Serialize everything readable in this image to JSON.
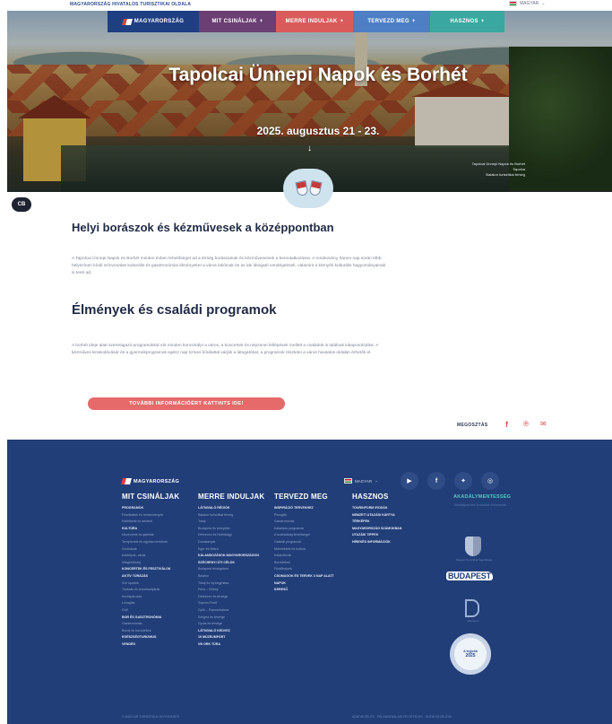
{
  "topbar": {
    "site": "MAGYARORSZÁG HIVATALOS TURISZTIKAI OLDALA",
    "language": "MAGYAR"
  },
  "nav": {
    "brand": "MAGYARORSZÁG",
    "items": [
      {
        "label": "MIT CSINÁLJAK"
      },
      {
        "label": "MERRE INDULJAK"
      },
      {
        "label": "TERVEZD MEG"
      },
      {
        "label": "HASZNOS"
      }
    ],
    "plus": "+"
  },
  "hero": {
    "title": "Tapolcai Ünnepi Napok és Borhét",
    "date": "2025. augusztus 21 - 23.",
    "arrow": "↓",
    "caption": "Tapolcai Ünnepi Napok és Borhét\nTapolca\nBalaton turisztikai térség"
  },
  "cookie_badge": "CB",
  "content": {
    "heading1": "Helyi borászok és kézművesek a középpontban",
    "para1": "A Tapolcai Ünnepi Napok és Borhét minden évben lehetőséget ad a térség borászainak és kézműveseinek a bemutatkozásra. A rendezvény három nap során több helyszínen kínál színvonalas kulturális és gasztronómiai élményeket a város lakóinak és az ide látogató vendégeknek, valamint a környék kulturális hagyományainak is teret ad.",
    "heading2": "Élmények és családi programok",
    "para2": "A borhét ideje alatt szerteágazó programokkal vár minden korosztályt a város, a koncertek és népzenei fellépések mellett a családok is találnak kikapcsolódást. A kézműves kirakodóvásár és a gyermekprogramok egész nap színes kínálattal várják a látogatókat, a programok részletei a város hivatalos oldalán érhetők el.",
    "cta": "TOVÁBBI INFORMÁCIÓÉRT KATTINTS IDE!",
    "share": "MEGOSZTÁS"
  },
  "footer": {
    "brand": "MAGYARORSZÁG",
    "language": "MAGYAR",
    "columns": [
      {
        "title": "MIT CSINÁLJAK",
        "items": [
          {
            "t": "PROGRAMOK",
            "b": true
          },
          {
            "t": "Fesztiválok és rendezvények",
            "b": false
          },
          {
            "t": "Kiállítások és tárlatok",
            "b": false
          },
          {
            "t": "KULTÚRA",
            "b": true
          },
          {
            "t": "Múzeumok és galériák",
            "b": false
          },
          {
            "t": "Templomok és egyházi emlékek",
            "b": false
          },
          {
            "t": "Színházak",
            "b": false
          },
          {
            "t": "Kastélyok, várak",
            "b": false
          },
          {
            "t": "Világörökség",
            "b": false
          },
          {
            "t": "KONCERTEK ÉS FESZTIVÁLOK",
            "b": true
          },
          {
            "t": "AKTÍV TÚRÁZÁS",
            "b": true
          },
          {
            "t": "Vízi sportok",
            "b": false
          },
          {
            "t": "Túrázás és természetjárás",
            "b": false
          },
          {
            "t": "Kerékpározás",
            "b": false
          },
          {
            "t": "Lovaglás",
            "b": false
          },
          {
            "t": "Golf",
            "b": false
          },
          {
            "t": "BOR ÉS GASZTRONÓMIA",
            "b": true
          },
          {
            "t": "Gasztronómia",
            "b": false
          },
          {
            "t": "Borok és borvidékek",
            "b": false
          },
          {
            "t": "EGÉSZSÉGTURIZMUS",
            "b": true
          },
          {
            "t": "VENDÉG",
            "b": true
          }
        ]
      },
      {
        "title": "MERRE INDULJAK",
        "items": [
          {
            "t": "LÁTNIVALÓ RÉGIÓK",
            "b": true
          },
          {
            "t": "Balaton turisztikai térség",
            "b": false
          },
          {
            "t": "Tokaj",
            "b": false
          },
          {
            "t": "Budapest és környéke",
            "b": false
          },
          {
            "t": "Debrecen és Hortobágy",
            "b": false
          },
          {
            "t": "Dunakanyar",
            "b": false
          },
          {
            "t": "Eger és Mátra",
            "b": false
          },
          {
            "t": "KALANDOZÁSOK MAGYARORSZÁGON",
            "b": true
          },
          {
            "t": "SZÉCHENYI ÚTI CÉLOK",
            "b": true
          },
          {
            "t": "Budapest térségében",
            "b": false
          },
          {
            "t": "Balaton",
            "b": false
          },
          {
            "t": "Tokaj és Nyíregyháza",
            "b": false
          },
          {
            "t": "Pécs – Villány",
            "b": false
          },
          {
            "t": "Debrecen és térsége",
            "b": false
          },
          {
            "t": "Sopron-Fertő",
            "b": false
          },
          {
            "t": "Győr – Pannonhalma",
            "b": false
          },
          {
            "t": "Szeged és térsége",
            "b": false
          },
          {
            "t": "Gyula és térsége",
            "b": false
          },
          {
            "t": "LÁTNIVALÓ KEDVEZ",
            "b": true
          },
          {
            "t": "10 MÚZEUMPÁRT",
            "b": true
          },
          {
            "t": "VB ORK TÚRA",
            "b": true
          }
        ]
      },
      {
        "title": "TERVEZD MEG",
        "items": [
          {
            "t": "INSPIRÁCIÓ TERVEKHEZ",
            "b": true
          },
          {
            "t": "Pezsgők",
            "b": false
          },
          {
            "t": "Gasztronómia",
            "b": false
          },
          {
            "t": "Kalandos programok",
            "b": false
          },
          {
            "t": "A szabadság lehetőségei",
            "b": false
          },
          {
            "t": "Családi programok",
            "b": false
          },
          {
            "t": "Műemlékek és kultúra",
            "b": false
          },
          {
            "t": "Kalandtúrák",
            "b": false
          },
          {
            "t": "Borvidékek",
            "b": false
          },
          {
            "t": "Fürdőhelyek",
            "b": false
          },
          {
            "t": "CSOMAGOK ÉS TERVEK 3 NAP ALATT",
            "b": true
          },
          {
            "t": "NAPOK",
            "b": true
          },
          {
            "t": "KERESŐ",
            "b": true
          }
        ]
      },
      {
        "title": "HASZNOS",
        "items": [
          {
            "t": "TOURINFORM IRODÁK",
            "b": true
          },
          {
            "t": "NEMZETI UTAZÁSI KÁRTYA",
            "b": true
          },
          {
            "t": "TÉRKÉPEK",
            "b": true
          },
          {
            "t": "MAGYARORSZÁG SZÁMOKBAN",
            "b": true
          },
          {
            "t": "UTAZÁSI TIPPEK",
            "b": true
          },
          {
            "t": "HÍREKÉS INFORMÁCIÓK",
            "b": true
          }
        ]
      }
    ],
    "accessibility": "AKADÁLYMENTESSÉG",
    "accessibility_sub": "Akadálymentes turisztikai információk",
    "coat_label": "Magyar Turisztikai Ügynökség",
    "budapest": "BUDAPEST",
    "d_label": "Debrecen",
    "seal_top": "A legjobb",
    "seal_year": "2025",
    "bottom_left": "© MAGYAR TURISZTIKAI ÜGYNÖKSÉG",
    "bottom_right": "ADATKEZELÉS · FELHASZNÁLÁSI FELTÉTELEK · SÜTIK KEZELÉSE"
  },
  "colors": {
    "nav_brand": "#1f3f83",
    "nav_a": "#6b3f73",
    "nav_b": "#d95b5b",
    "nav_c": "#4d7fc4",
    "nav_d": "#3aa8a0",
    "cta": "#e66a6a",
    "footer": "#213e78",
    "accessibility": "#56c9c1"
  },
  "icons": [
    "hungary-flag-icon",
    "arrow-down-icon",
    "wine-glasses-badge",
    "facebook-icon",
    "pinterest-icon",
    "email-icon",
    "youtube-icon",
    "twitter-icon",
    "instagram-icon",
    "coat-of-arms-icon"
  ]
}
